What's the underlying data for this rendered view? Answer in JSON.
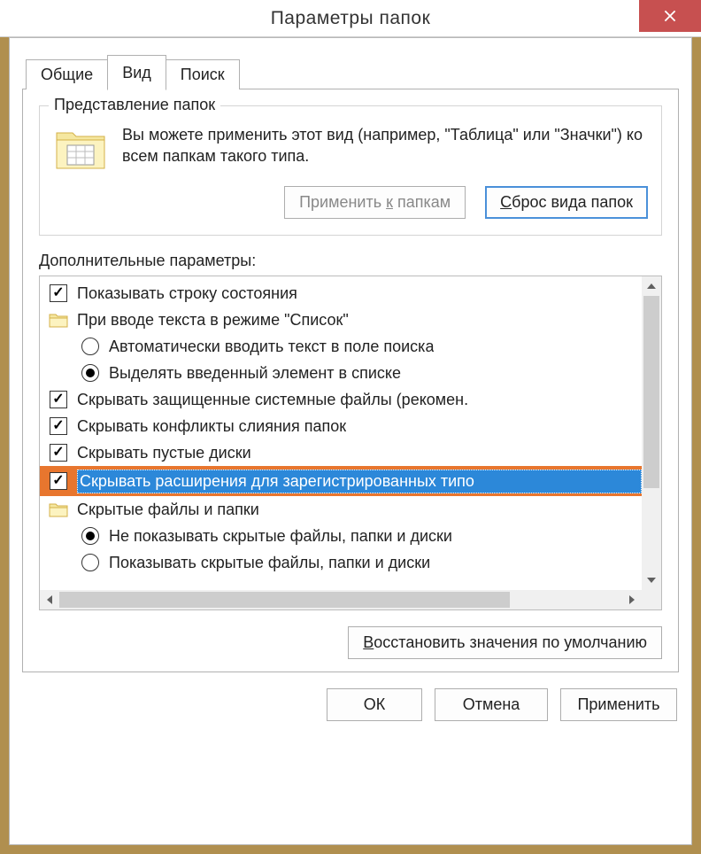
{
  "title": "Параметры папок",
  "tabs": {
    "general": "Общие",
    "view": "Вид",
    "search": "Поиск"
  },
  "folderview": {
    "groupTitle": "Представление папок",
    "description": "Вы можете применить этот вид (например, \"Таблица\" или \"Значки\") ко всем папкам такого типа.",
    "applyBtn": "Применить к папкам",
    "applyAccess": "к",
    "resetBtn": "Сброс вида папок",
    "resetAccess": "С"
  },
  "advanced": {
    "label": "Дополнительные параметры:",
    "items": [
      {
        "type": "checkbox",
        "checked": true,
        "indent": 0,
        "label": "Показывать строку состояния",
        "highlight": false
      },
      {
        "type": "folder",
        "indent": 0,
        "label": "При вводе текста в режиме \"Список\"",
        "highlight": false
      },
      {
        "type": "radio",
        "checked": false,
        "indent": 1,
        "label": "Автоматически вводить текст в поле поиска",
        "highlight": false
      },
      {
        "type": "radio",
        "checked": true,
        "indent": 1,
        "label": "Выделять введенный элемент в списке",
        "highlight": false
      },
      {
        "type": "checkbox",
        "checked": true,
        "indent": 0,
        "label": "Скрывать защищенные системные файлы (рекомен.",
        "highlight": false
      },
      {
        "type": "checkbox",
        "checked": true,
        "indent": 0,
        "label": "Скрывать конфликты слияния папок",
        "highlight": false
      },
      {
        "type": "checkbox",
        "checked": true,
        "indent": 0,
        "label": "Скрывать пустые диски",
        "highlight": false
      },
      {
        "type": "checkbox",
        "checked": true,
        "indent": 0,
        "label": "Скрывать расширения для зарегистрированных типо",
        "highlight": true
      },
      {
        "type": "folder",
        "indent": 0,
        "label": "Скрытые файлы и папки",
        "highlight": false
      },
      {
        "type": "radio",
        "checked": true,
        "indent": 1,
        "label": "Не показывать скрытые файлы, папки и диски",
        "highlight": false
      },
      {
        "type": "radio",
        "checked": false,
        "indent": 1,
        "label": "Показывать скрытые файлы, папки и диски",
        "highlight": false
      }
    ],
    "restoreBtn": "Восстановить значения по умолчанию",
    "restoreAccess": "В"
  },
  "buttons": {
    "ok": "ОК",
    "cancel": "Отмена",
    "apply": "Применить"
  }
}
